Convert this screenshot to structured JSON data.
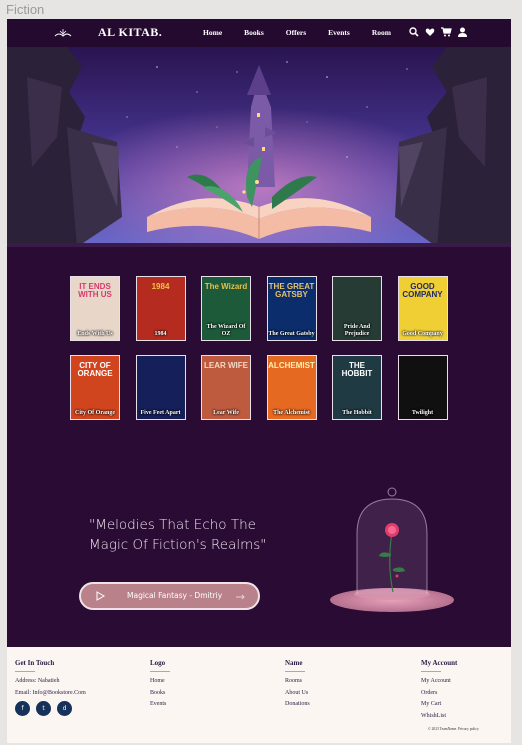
{
  "frame_label": "Fiction",
  "header": {
    "brand": "AL KITAB.",
    "nav": [
      "Home",
      "Books",
      "Offers",
      "Events",
      "Room"
    ],
    "icons": [
      "search-icon",
      "heart-icon",
      "cart-icon",
      "user-icon"
    ]
  },
  "books": [
    {
      "title": "Ends With Us",
      "cover": "IT ENDS WITH US",
      "bg": "#e8d6c8",
      "fg": "#d63a6e"
    },
    {
      "title": "1984",
      "cover": "1984",
      "bg": "#b52b1f",
      "fg": "#f2c440"
    },
    {
      "title": "The Wizard Of OZ",
      "cover": "The Wizard",
      "bg": "#1c5a3a",
      "fg": "#e7c04a"
    },
    {
      "title": "The Great Gatsby",
      "cover": "THE GREAT GATSBY",
      "bg": "#0b2d6c",
      "fg": "#e5c36a"
    },
    {
      "title": "Pride And Prejudice",
      "cover": "",
      "bg": "#253b34",
      "fg": "#c7b676"
    },
    {
      "title": "Good Company",
      "cover": "GOOD COMPANY",
      "bg": "#f0cf35",
      "fg": "#1c2a6a"
    },
    {
      "title": "City Of Orange",
      "cover": "CITY OF ORANGE",
      "bg": "#d0451e",
      "fg": "#ffffff"
    },
    {
      "title": "Five Feet Apart",
      "cover": "",
      "bg": "#15205a",
      "fg": "#f0a0b0"
    },
    {
      "title": "Lear Wife",
      "cover": "LEAR WIFE",
      "bg": "#be5a3e",
      "fg": "#f3d8c8"
    },
    {
      "title": "The Alchemist",
      "cover": "ALCHEMIST",
      "bg": "#e66922",
      "fg": "#fff2b0"
    },
    {
      "title": "The Hobbit",
      "cover": "THE HOBBIT",
      "bg": "#203a44",
      "fg": "#ffffff"
    },
    {
      "title": "Twilight",
      "cover": "",
      "bg": "#101010",
      "fg": "#ffffff"
    }
  ],
  "quote": {
    "line1": "\"Melodies That Echo The",
    "line2": "Magic Of Fiction's Realms\""
  },
  "player": {
    "track": "Magical Fantasy - Dmitriy"
  },
  "footer": {
    "contact": {
      "heading": "Get In Touch",
      "address": "Address: Nabatieh",
      "email": "Email: Info@Bookstore.Com",
      "social": [
        "f",
        "t",
        "d"
      ]
    },
    "logo": {
      "heading": "Logo",
      "links": [
        "Home",
        "Books",
        "Events"
      ]
    },
    "name": {
      "heading": "Name",
      "links": [
        "Rooms",
        "About Us",
        "Donations"
      ]
    },
    "account": {
      "heading": "My Account",
      "links": [
        "My Account",
        "Orders",
        "My Cart",
        "WhishList"
      ]
    },
    "copyright": "© 2023 TeamName. Privacy policy"
  }
}
